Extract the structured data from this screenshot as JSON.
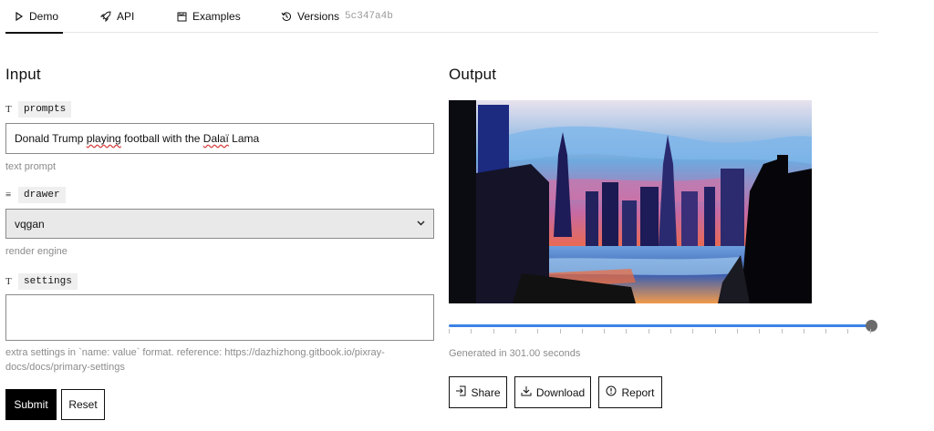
{
  "tabs": [
    {
      "label": "Demo",
      "icon": "play-icon",
      "active": true
    },
    {
      "label": "API",
      "icon": "rocket-icon"
    },
    {
      "label": "Examples",
      "icon": "image-icon"
    },
    {
      "label": "Versions",
      "icon": "history-icon",
      "hash": "5c347a4b"
    }
  ],
  "input": {
    "heading": "Input",
    "fields": [
      {
        "type_icon": "T",
        "name": "prompts",
        "value_plain": "Donald Trump ",
        "value_misspelled": "playing",
        "value_mid": " football with the ",
        "value_misspelled2": "Dalaï",
        "value_end": " Lama",
        "help": "text prompt"
      },
      {
        "type_icon": "≡",
        "name": "drawer",
        "value": "vqgan",
        "help": "render engine"
      },
      {
        "type_icon": "T",
        "name": "settings",
        "value": "",
        "help_line1": "extra settings in `name: value` format. reference: https://dazhizhong.gitbook.io/pixray-",
        "help_line2": "docs/docs/primary-settings"
      }
    ],
    "submit_label": "Submit",
    "reset_label": "Reset"
  },
  "output": {
    "heading": "Output",
    "generated_text": "Generated in 301.00 seconds",
    "slider_progress": 1.0,
    "buttons": {
      "share": "Share",
      "download": "Download",
      "report": "Report"
    }
  },
  "colors": {
    "accent": "#3b82e6",
    "thumb": "#6b6b6b"
  }
}
